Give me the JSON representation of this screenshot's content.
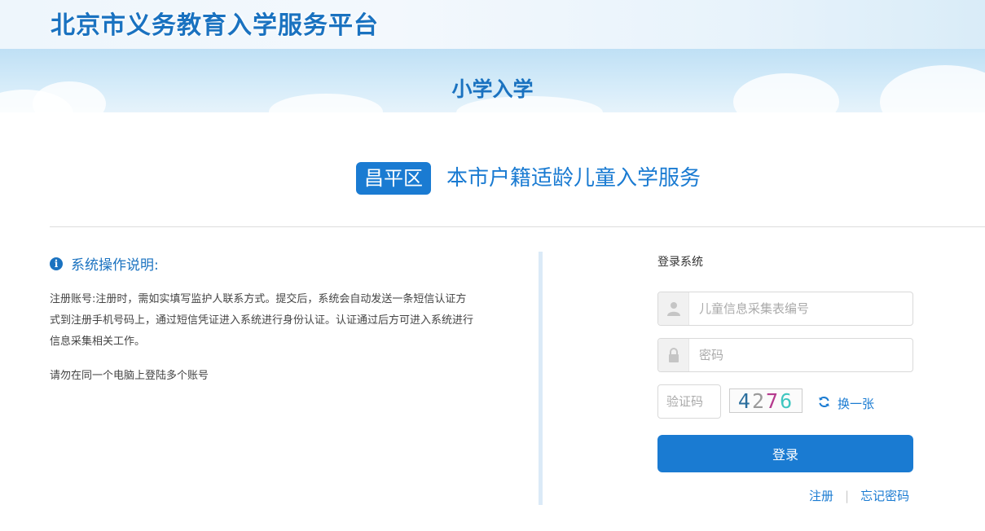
{
  "header": {
    "site_title": "北京市义务教育入学服务平台",
    "banner_title": "小学入学"
  },
  "heading": {
    "district": "昌平区",
    "service_title": "本市户籍适龄儿童入学服务"
  },
  "instructions": {
    "title": "系统操作说明:",
    "icon": "info-icon",
    "paragraph": "注册账号:注册时，需如实填写监护人联系方式。提交后，系统会自动发送一条短信认证方式到注册手机号码上，通过短信凭证进入系统进行身份认证。认证通过后方可进入系统进行信息采集相关工作。",
    "note": "请勿在同一个电脑上登陆多个账号"
  },
  "login": {
    "title": "登录系统",
    "username_placeholder": "儿童信息采集表编号",
    "password_placeholder": "密码",
    "captcha_placeholder": "验证码",
    "captcha_digits": [
      "4",
      "2",
      "7",
      "6"
    ],
    "refresh_label": "换一张",
    "submit_label": "登录",
    "register_label": "注册",
    "forgot_label": "忘记密码"
  },
  "colors": {
    "accent": "#1a7bd2",
    "title_blue": "#1a72c0",
    "captcha": [
      "#2b6f9e",
      "#9a9a9a",
      "#b53a8e",
      "#3fc6c0"
    ]
  }
}
